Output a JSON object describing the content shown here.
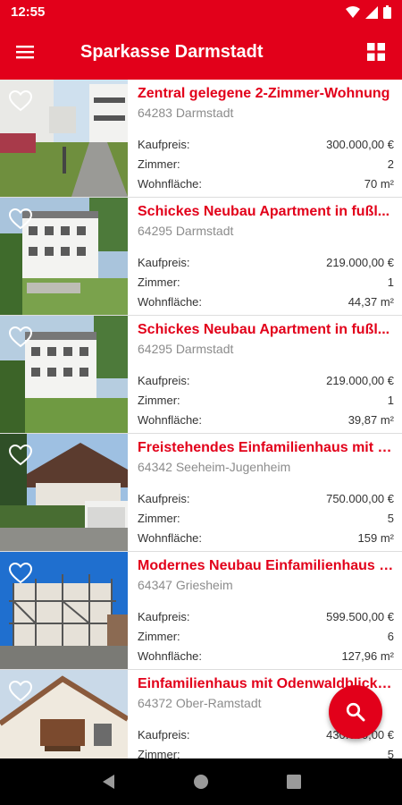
{
  "status": {
    "time": "12:55"
  },
  "appbar": {
    "title": "Sparkasse Darmstadt"
  },
  "labels": {
    "price": "Kaufpreis:",
    "rooms": "Zimmer:",
    "area": "Wohnfläche:"
  },
  "listings": [
    {
      "title": "Zentral gelegene 2-Zimmer-Wohnung",
      "location": "64283 Darmstadt",
      "price": "300.000,00 €",
      "rooms": "2",
      "area": "70 m²"
    },
    {
      "title": "Schickes Neubau Apartment in fußl...",
      "location": "64295 Darmstadt",
      "price": "219.000,00 €",
      "rooms": "1",
      "area": "44,37 m²"
    },
    {
      "title": "Schickes Neubau Apartment in fußl...",
      "location": "64295 Darmstadt",
      "price": "219.000,00 €",
      "rooms": "1",
      "area": "39,87 m²"
    },
    {
      "title": "Freistehendes Einfamilienhaus mit g...",
      "location": "64342 Seeheim-Jugenheim",
      "price": "750.000,00 €",
      "rooms": "5",
      "area": "159 m²"
    },
    {
      "title": "Modernes Neubau Einfamilienhaus i...",
      "location": "64347 Griesheim",
      "price": "599.500,00 €",
      "rooms": "6",
      "area": "127,96 m²"
    },
    {
      "title": "Einfamilienhaus mit Odenwaldblick i...",
      "location": "64372 Ober-Ramstadt",
      "price": "430.000,00 €",
      "rooms": "5",
      "area": ""
    }
  ],
  "colors": {
    "brand": "#e2001a",
    "muted": "#8c8c8c"
  }
}
